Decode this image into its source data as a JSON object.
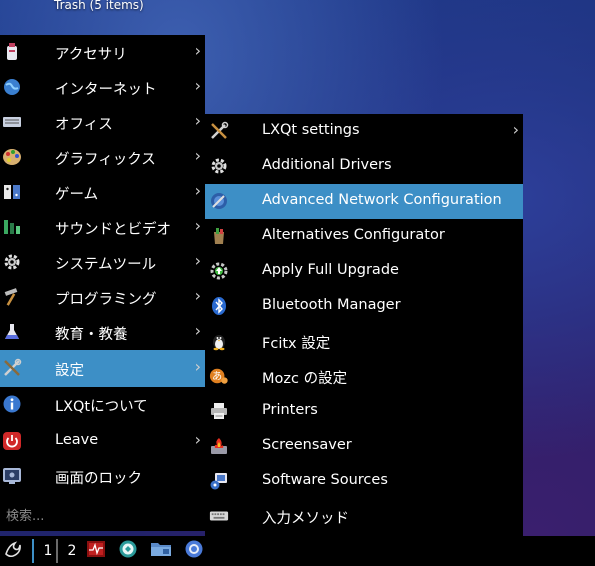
{
  "desktop": {
    "trash_label": "Trash (5 items)"
  },
  "main_menu": {
    "items": [
      {
        "label": "アクセサリ",
        "icon": "accessories-icon",
        "submenu": true
      },
      {
        "label": "インターネット",
        "icon": "globe-icon",
        "submenu": true
      },
      {
        "label": "オフィス",
        "icon": "office-icon",
        "submenu": true
      },
      {
        "label": "グラフィックス",
        "icon": "palette-icon",
        "submenu": true
      },
      {
        "label": "ゲーム",
        "icon": "games-icon",
        "submenu": true
      },
      {
        "label": "サウンドとビデオ",
        "icon": "multimedia-icon",
        "submenu": true
      },
      {
        "label": "システムツール",
        "icon": "gear-icon",
        "submenu": true
      },
      {
        "label": "プログラミング",
        "icon": "hammer-icon",
        "submenu": true
      },
      {
        "label": "教育・教養",
        "icon": "flask-icon",
        "submenu": true
      },
      {
        "label": "設定",
        "icon": "settings-tools-icon",
        "submenu": true,
        "active": true
      },
      {
        "label": "LXQtについて",
        "icon": "info-icon",
        "submenu": false
      },
      {
        "label": "Leave",
        "icon": "power-icon",
        "submenu": true
      },
      {
        "label": "画面のロック",
        "icon": "lock-screen-icon",
        "submenu": false
      }
    ]
  },
  "search": {
    "placeholder": "検索..."
  },
  "sub_menu": {
    "items": [
      {
        "label": "LXQt settings",
        "icon": "tools-icon",
        "submenu": true
      },
      {
        "label": "Additional Drivers",
        "icon": "gear-icon",
        "submenu": false
      },
      {
        "label": "Advanced Network Configuration",
        "icon": "network-icon",
        "submenu": false,
        "active": true
      },
      {
        "label": "Alternatives Configurator",
        "icon": "alternatives-icon",
        "submenu": false
      },
      {
        "label": "Apply Full Upgrade",
        "icon": "upgrade-icon",
        "submenu": false
      },
      {
        "label": "Bluetooth Manager",
        "icon": "bluetooth-icon",
        "submenu": false
      },
      {
        "label": "Fcitx 設定",
        "icon": "penguin-icon",
        "submenu": false
      },
      {
        "label": "Mozc の設定",
        "icon": "mozc-icon",
        "submenu": false
      },
      {
        "label": "Printers",
        "icon": "printer-icon",
        "submenu": false
      },
      {
        "label": "Screensaver",
        "icon": "screensaver-icon",
        "submenu": false
      },
      {
        "label": "Software Sources",
        "icon": "software-sources-icon",
        "submenu": false
      },
      {
        "label": "入力メソッド",
        "icon": "keyboard-icon",
        "submenu": false
      }
    ]
  },
  "taskbar": {
    "workspaces": [
      "1",
      "2"
    ],
    "current_workspace": "1",
    "launchers": [
      "task-manager-icon",
      "browser-icon",
      "file-manager-icon",
      "chromium-icon"
    ]
  },
  "colors": {
    "menu_bg": "#000000",
    "highlight": "#3d8fc6",
    "text": "#ffffff"
  }
}
